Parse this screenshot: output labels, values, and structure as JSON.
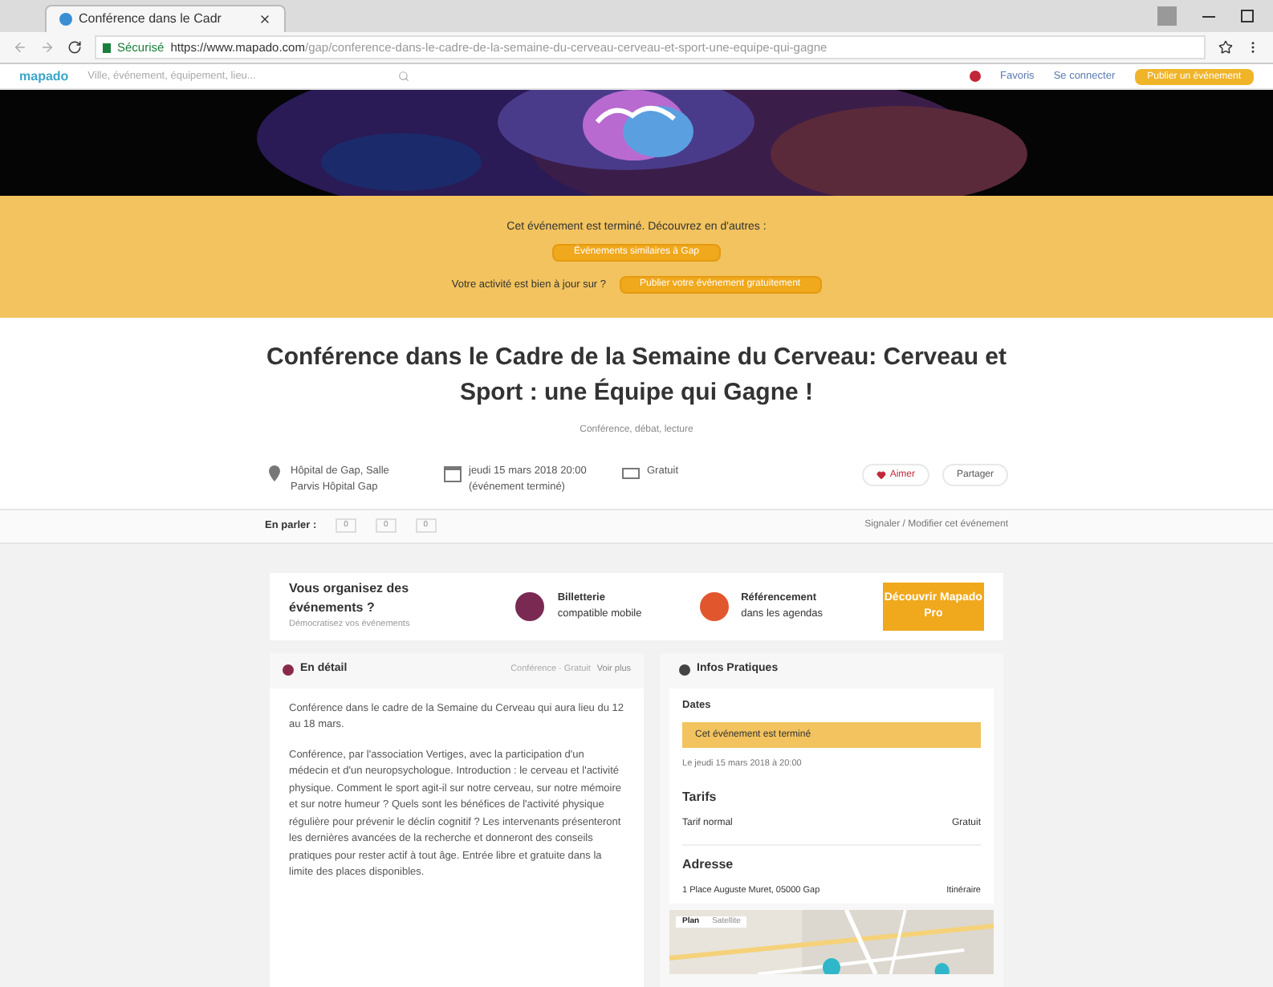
{
  "browser": {
    "tab_title": "Conférence dans le Cadr",
    "secure_label": "Sécurisé",
    "url_host": "https://www.mapado.com",
    "url_path": "/gap/conference-dans-le-cadre-de-la-semaine-du-cerveau-cerveau-et-sport-une-equipe-qui-gagne"
  },
  "site_header": {
    "logo": "mapado",
    "search_placeholder": "Ville, événement, équipement, lieu...",
    "links": [
      "Favoris",
      "Se connecter"
    ],
    "cta": "Publier un événement"
  },
  "ended_banner": {
    "message": "Cet événement est terminé. Découvrez en d'autres :",
    "button": "Événements similaires à Gap",
    "question": "Votre activité est bien à jour sur ?",
    "question_button": "Publier votre événement gratuitement"
  },
  "event": {
    "title": "Conférence dans le Cadre de la Semaine du Cerveau: Cerveau et Sport : une Équipe qui Gagne !",
    "category": "Conférence, débat, lecture",
    "meta": [
      {
        "kind": "place",
        "text": "Hôpital de Gap, Salle Parvis Hôpital Gap"
      },
      {
        "kind": "date",
        "text": "jeudi 15 mars 2018 20:00 (événement terminé)"
      },
      {
        "kind": "price",
        "text": "Gratuit"
      }
    ],
    "actions": [
      {
        "label": "Aimer",
        "kind": "like"
      },
      {
        "label": "Partager",
        "kind": "share"
      }
    ]
  },
  "share_bar": {
    "label": "En parler :",
    "counts": [
      "0",
      "0",
      "0"
    ],
    "report": "Signaler / Modifier cet événement"
  },
  "promo": {
    "title": "Vous organisez des événements ?",
    "subtitle": "Démocratisez vos événements",
    "features": [
      {
        "title": "Billetterie",
        "text": "compatible mobile",
        "color": "#7a2a52"
      },
      {
        "title": "Référencement",
        "text": "dans les agendas",
        "color": "#e2562d"
      }
    ],
    "button": "Découvrir Mapado Pro"
  },
  "detail": {
    "title": "En détail",
    "meta": "Conférence · Gratuit",
    "link": "Voir plus",
    "paragraphs": [
      "Conférence dans le cadre de la Semaine du Cerveau qui aura lieu du 12 au 18 mars.",
      "Conférence, par l'association Vertiges, avec la participation d'un médecin et d'un neuropsychologue. Introduction : le cerveau et l'activité physique. Comment le sport agit-il sur notre cerveau, sur notre mémoire et sur notre humeur ? Quels sont les bénéfices de l'activité physique régulière pour prévenir le déclin cognitif ? Les intervenants présenteront les dernières avancées de la recherche et donneront des conseils pratiques pour rester actif à tout âge. Entrée libre et gratuite dans la limite des places disponibles."
    ]
  },
  "infos": {
    "title": "Infos Pratiques",
    "dates_heading": "Dates",
    "dates_badge": "Cet événement est terminé",
    "date_line": "Le jeudi 15 mars 2018 à 20:00",
    "tarifs_heading": "Tarifs",
    "tarifs": [
      {
        "label": "Tarif normal",
        "value": "Gratuit"
      }
    ],
    "address_heading": "Adresse",
    "address": "1 Place Auguste Muret, 05000 Gap",
    "route": "Itinéraire",
    "map_tabs": [
      {
        "label": "Plan",
        "selected": true
      },
      {
        "label": "Satellite",
        "selected": false
      }
    ]
  }
}
